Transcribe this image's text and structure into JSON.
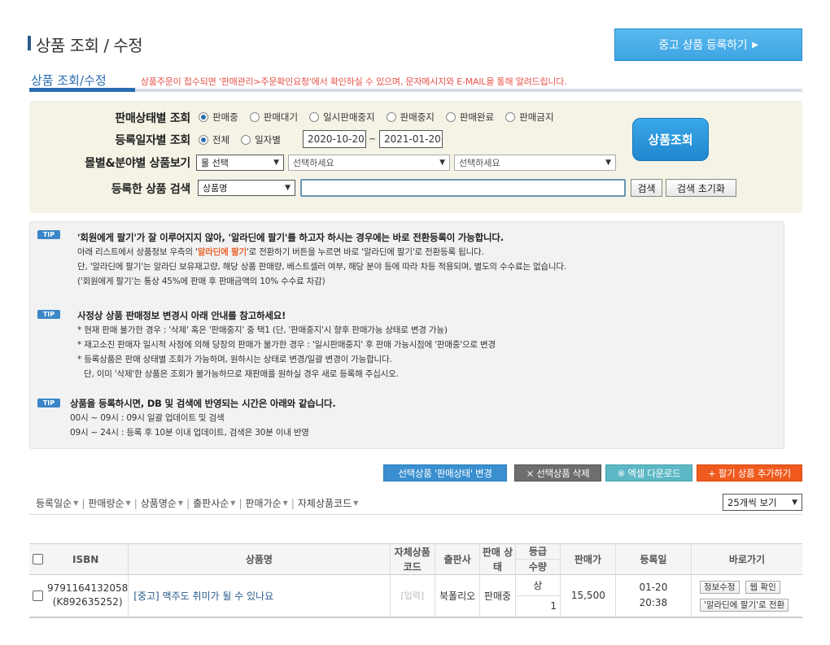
{
  "header": {
    "title": "상품 조회 / 수정",
    "register_button": "중고 상품 등록하기",
    "register_arrow": "▶"
  },
  "tab": {
    "label": "상품 조회/수정",
    "notice": "상품주문이 접수되면 '판매관리>주문확인요청'에서 확인하실 수 있으며, 문자메시지와 E-MAIL을 통해 알려드립니다."
  },
  "search": {
    "status_label": "판매상태별 조회",
    "status_options": [
      "판매중",
      "판매대기",
      "일시판매중지",
      "판매중지",
      "판매완료",
      "판매금지"
    ],
    "status_selected": "판매중",
    "date_label": "등록일자별 조회",
    "date_options": [
      "전체",
      "일자별"
    ],
    "date_selected": "전체",
    "date_from": "2020-10-20",
    "date_sep": "~",
    "date_to": "2021-01-20",
    "mall_label": "몰별&분야별 상품보기",
    "mall_select": "몰 선택",
    "field_select_1": "선택하세요",
    "field_select_2": "선택하세요",
    "keyword_label": "등록한 상품 검색",
    "keyword_type": "상품명",
    "keyword_value": "",
    "search_button": "검색",
    "reset_button": "검색 초기화",
    "query_button": "상품조회"
  },
  "tips": {
    "badge": "TIP",
    "tip1": {
      "head": "'회원에게 팔기'가 잘 이루어지지 않아, '알라딘에 팔기'를 하고자 하시는 경우에는 바로 전환등록이 가능합니다.",
      "line1_pre": "아래 리스트에서 상품정보 우측의 '",
      "line1_hl": "알라딘에 팔기",
      "line1_post": "'로 전환하기 버튼을 누르면 바로 '알라딘에 팔기'로 전환등록 됩니다.",
      "line2": "단, '알라딘에 팔기'는 알라딘 보유재고량, 해당 상품 판매량, 베스트셀러 여부, 해당 분야 등에 따라 차등 적용되며, 별도의 수수료는 없습니다.",
      "line3": "('회원에게 팔기'는 통상 45%에 판매 후 판매금액의 10% 수수료 차감)"
    },
    "tip2": {
      "head": "사정상 상품 판매정보 변경시 아래 안내를 참고하세요!",
      "line1": "* 현재 판매 불가한 경우 : '삭제' 혹은 '판매중지' 중 택1 (단, '판매중지'시 향후 판매가능 상태로 변경 가능)",
      "line2": "* 재고소진 판매자 일시적 사정에 의해 당장의 판매가 불가한 경우 : '일시판매중지' 후 판매 가능시점에 '판매중'으로 변경",
      "line3": "* 등록상품은 판매 상태별 조회가 가능하며, 원하시는 상태로 변경/일괄 변경이 가능합니다.",
      "line4": "단, 이미 '삭제'한 상품은 조회가 불가능하므로 재판매를 원하실 경우 새로 등록해 주십시오."
    },
    "tip3": {
      "head": "상품을 등록하시면, DB 및 검색에 반영되는 시간은 아래와 같습니다.",
      "line1": "00시 ~ 09시 : 09시 일괄 업데이트 및 검색",
      "line2": "09시 ~ 24시 : 등록 후 10분 이내 업데이트, 검색은 30분 이내 반영"
    }
  },
  "actions": {
    "change_status": "선택상품 '판매상태' 변경",
    "delete": "× 선택상품 삭제",
    "excel": "※ 엑셀 다운로드",
    "add_alladin": "+ 팔기 상품 추가하기",
    "colors": {
      "change": "#3a8fd0",
      "delete": "#6e6e6e",
      "excel": "#5cb8c4",
      "add": "#f05a1e"
    }
  },
  "sort": {
    "items": [
      "등록일순",
      "판매량순",
      "상품명순",
      "출판사순",
      "판매가순",
      "자체상품코드"
    ],
    "separator": "|",
    "page_size": "25개씩 보기"
  },
  "table": {
    "headers": {
      "isbn": "ISBN",
      "name": "상품명",
      "code": "자체상품 코드",
      "publisher": "출판사",
      "status": "판매 상태",
      "grade": "등급",
      "qty": "수량",
      "price": "판매가",
      "date": "등록일",
      "shortcut": "바로가기"
    },
    "rows": [
      {
        "isbn": "9791164132058",
        "isbn_sub": "(K892635252)",
        "name": "[중고] 맥주도 취미가 될 수 있나요",
        "code": "[입력]",
        "publisher": "북폴리오",
        "status": "판매중",
        "grade": "상",
        "qty": "1",
        "price": "15,500",
        "date": "01-20",
        "time": "20:38",
        "btn_edit": "정보수정",
        "btn_web": "웹 확인",
        "btn_convert": "'알라딘에 팔기'로 전환"
      }
    ]
  }
}
